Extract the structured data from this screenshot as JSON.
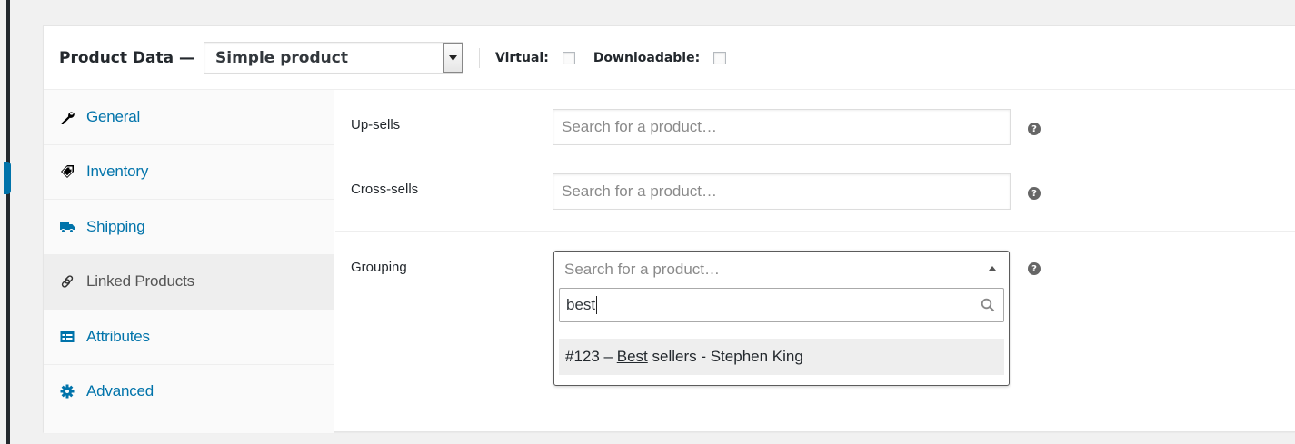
{
  "header": {
    "title": "Product Data —",
    "product_type": "Simple product",
    "virtual_label": "Virtual:",
    "downloadable_label": "Downloadable:"
  },
  "tabs": [
    {
      "label": "General",
      "icon": "wrench-icon"
    },
    {
      "label": "Inventory",
      "icon": "tag-icon"
    },
    {
      "label": "Shipping",
      "icon": "truck-icon"
    },
    {
      "label": "Linked Products",
      "icon": "link-icon",
      "active": true
    },
    {
      "label": "Attributes",
      "icon": "list-card-icon"
    },
    {
      "label": "Advanced",
      "icon": "gear-icon"
    }
  ],
  "fields": {
    "upsells": {
      "label": "Up-sells",
      "placeholder": "Search for a product…"
    },
    "crosssells": {
      "label": "Cross-sells",
      "placeholder": "Search for a product…"
    },
    "grouping": {
      "label": "Grouping",
      "placeholder": "Search for a product…",
      "search_value": "best",
      "result_prefix": "#123 – ",
      "result_match": "Best",
      "result_suffix": " sellers - Stephen King"
    }
  },
  "help_glyph": "?",
  "colors": {
    "link": "#0073aa",
    "active_tab_bg": "#eeeeee",
    "admin_bar": "#23282d"
  }
}
